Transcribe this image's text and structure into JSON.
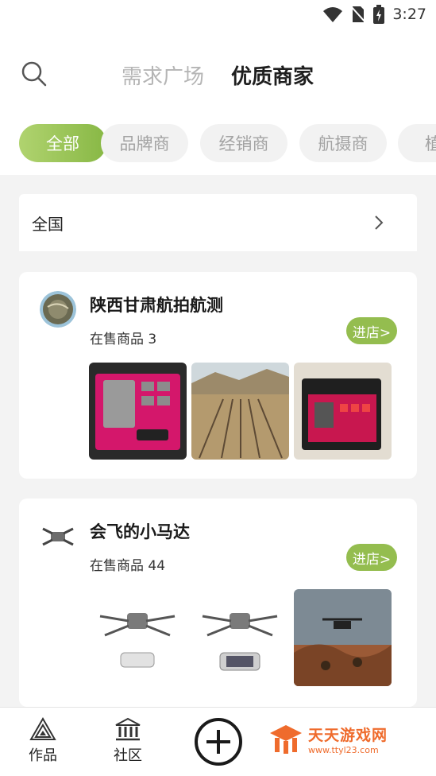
{
  "status_bar": {
    "time": "3:27"
  },
  "top_nav": {
    "tabs": [
      {
        "label": "需求广场",
        "active": false
      },
      {
        "label": "优质商家",
        "active": true
      }
    ]
  },
  "filter_chips": [
    {
      "label": "全部",
      "active": true
    },
    {
      "label": "品牌商",
      "active": false
    },
    {
      "label": "经销商",
      "active": false
    },
    {
      "label": "航摄商",
      "active": false
    },
    {
      "label": "植保",
      "active": false
    }
  ],
  "region": {
    "label": "全国"
  },
  "shops": [
    {
      "name": "陕西甘肃航拍航测",
      "count_label": "在售商品 3",
      "enter_label": "进店>"
    },
    {
      "name": "会飞的小马达",
      "count_label": "在售商品 44",
      "enter_label": "进店>"
    }
  ],
  "bottom_nav": {
    "works_label": "作品",
    "community_label": "社区"
  },
  "watermark": {
    "title": "天天游戏网",
    "url": "www.ttyl23.com"
  },
  "colors": {
    "accent": "#94bd4f",
    "chip_gradient_start": "#b0d36f",
    "chip_gradient_end": "#88b845"
  }
}
